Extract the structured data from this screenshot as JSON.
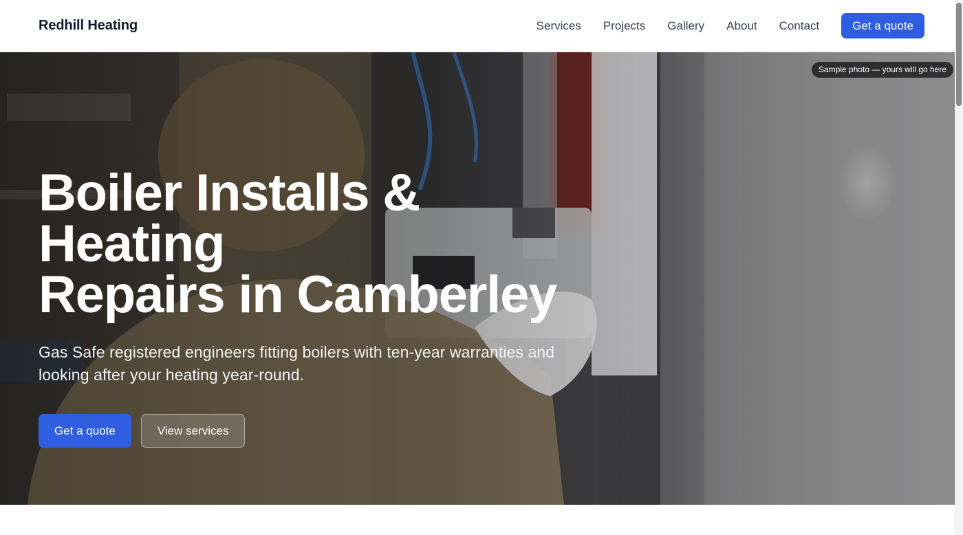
{
  "header": {
    "brand": "Redhill Heating",
    "nav": [
      "Services",
      "Projects",
      "Gallery",
      "About",
      "Contact"
    ],
    "cta_label": "Get a quote"
  },
  "hero": {
    "photo_badge": "Sample photo — yours will go here",
    "title_line1": "Boiler Installs & Heating",
    "title_line2": "Repairs in Camberley",
    "subtitle": "Gas Safe registered engineers fitting boilers with ten-year warranties and looking after your heating year-round.",
    "primary_label": "Get a quote",
    "secondary_label": "View services"
  },
  "colors": {
    "accent": "#2f5ee0",
    "header_bg": "#ffffff",
    "text_dark": "#111827"
  }
}
